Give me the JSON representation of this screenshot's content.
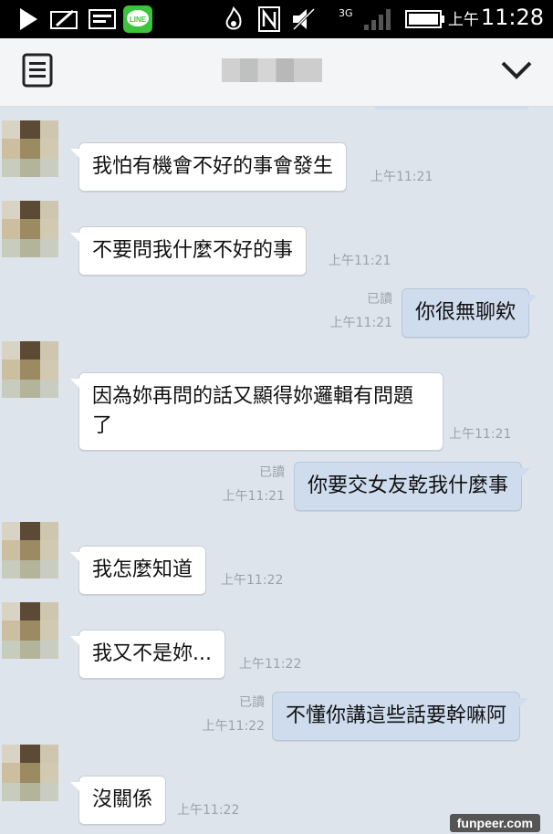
{
  "status_bar": {
    "ampm": "上午",
    "time": "11:28",
    "icons": [
      "play-icon",
      "feather-icon",
      "image-icon",
      "line-app-icon",
      "fire-icon",
      "nfc-icon",
      "mute-icon",
      "signal-icon",
      "battery-icon"
    ],
    "line_label": "LINE"
  },
  "header": {
    "menu_icon": "notes-icon",
    "collapse_icon": "chevron-down-icon"
  },
  "messages": [
    {
      "side": "recv",
      "text": "我怕有機會不好的事會發生",
      "time": "上午11:21"
    },
    {
      "side": "recv",
      "text": "不要問我什麼不好的事",
      "time": "上午11:21"
    },
    {
      "side": "sent",
      "text": "你很無聊欸",
      "read": "已讀",
      "time": "上午11:21"
    },
    {
      "side": "recv",
      "text": "因為妳再問的話又顯得妳邏輯有問題了",
      "time": "上午11:21"
    },
    {
      "side": "sent",
      "text": "你要交女友乾我什麼事",
      "read": "已讀",
      "time": "上午11:21"
    },
    {
      "side": "recv",
      "text": "我怎麼知道",
      "time": "上午11:22"
    },
    {
      "side": "recv",
      "text": "我又不是妳...",
      "time": "上午11:22"
    },
    {
      "side": "sent",
      "text": "不懂你講這些話要幹嘛阿",
      "read": "已讀",
      "time": "上午11:22"
    },
    {
      "side": "recv",
      "text": "沒關係",
      "time": "上午11:22"
    }
  ],
  "watermark": "funpeer.com"
}
